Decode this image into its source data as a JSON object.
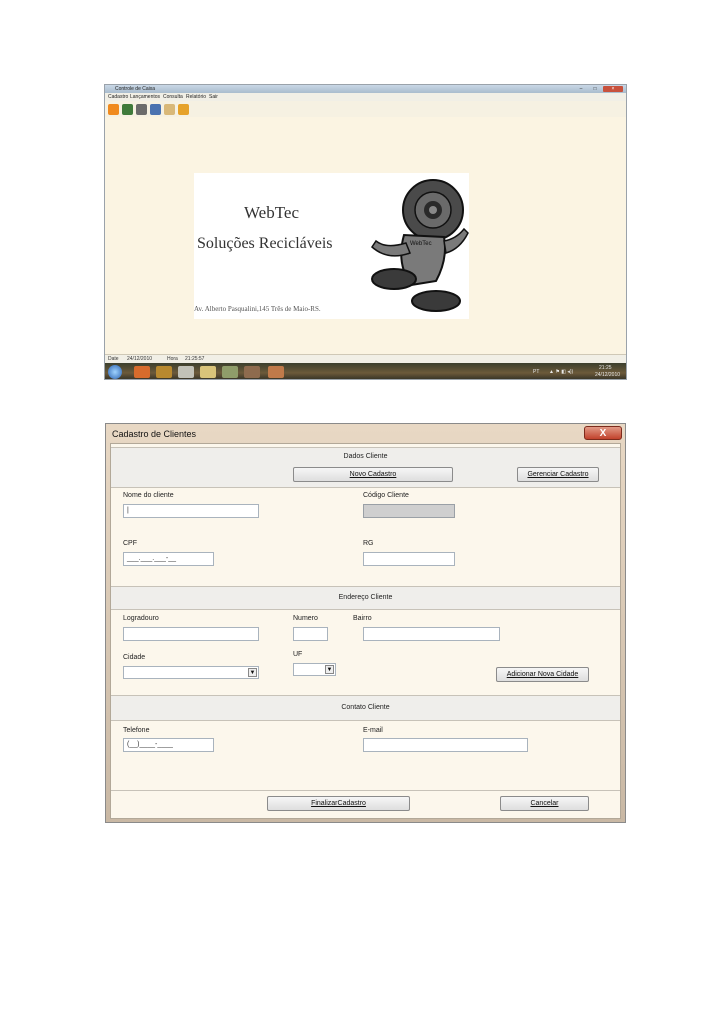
{
  "app": {
    "title": "Controle de Caixa",
    "window_buttons": [
      "–",
      "□",
      "×"
    ],
    "menu": [
      "Cadastro",
      "Lançamentos",
      "Consulta",
      "Relatório",
      "Sair"
    ],
    "toolbar_icons": [
      "folder-icon",
      "book-icon",
      "tools-icon",
      "gear-icon",
      "report-icon",
      "chart-icon"
    ],
    "logo": {
      "title": "WebTec",
      "subtitle": "Soluções Recicláveis",
      "address": "Av. Alberto Pasqualini,145 Três de Maio-RS.",
      "mascot_text": "WebTec"
    },
    "status": {
      "date_label": "Date",
      "date": "24/12/2010",
      "time_label": "Hora",
      "time": "21:25:57"
    },
    "taskbar": {
      "lang": "PT",
      "clock_time": "21:25",
      "clock_date": "24/12/2010"
    }
  },
  "dialog": {
    "title": "Cadastro de Clientes",
    "close": "X",
    "dados": {
      "title": "Dados Cliente",
      "novo_button": "Novo Cadastro",
      "gerenciar_button": "Gerenciar Cadastro"
    },
    "fields": {
      "nome_label": "Nome do cliente",
      "codigo_label": "Código Cliente",
      "cpf_label": "CPF",
      "cpf_value": "___.___.___-__",
      "rg_label": "RG"
    },
    "endereco": {
      "title": "Endereço Cliente",
      "logradouro_label": "Logradouro",
      "numero_label": "Numero",
      "bairro_label": "Bairro",
      "cidade_label": "Cidade",
      "uf_label": "UF",
      "add_cidade_button": "Adicionar Nova Cidade"
    },
    "contato": {
      "title": "Contato Cliente",
      "telefone_label": "Telefone",
      "telefone_value": "(__)____-____",
      "email_label": "E-mail"
    },
    "finalizar_button": "FinalizarCadastro",
    "cancelar_button": "Cancelar"
  }
}
